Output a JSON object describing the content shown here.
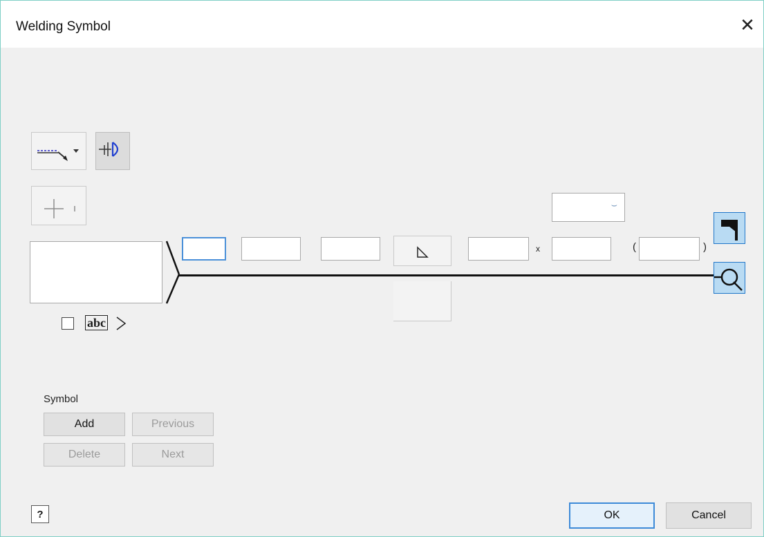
{
  "window": {
    "title": "Welding Symbol",
    "close_icon": "close-icon"
  },
  "toolbar": {
    "leader_icon": "leader-arrow-icon",
    "identification_line_icon": "identification-line-icon",
    "weld_all_around_icon": "weld-all-around-icon"
  },
  "reference": {
    "dimension_separator_x": "x",
    "paren_open": "(",
    "paren_close": ")",
    "contour_dropdown_value": ""
  },
  "tail": {
    "text_label": "abc",
    "checked": false
  },
  "side_buttons": {
    "field_weld_icon": "field-weld-flag-icon",
    "all_around_icon": "all-around-circle-icon"
  },
  "symbol_group": {
    "label": "Symbol",
    "add": "Add",
    "previous": "Previous",
    "delete": "Delete",
    "next": "Next"
  },
  "footer": {
    "help_icon": "help-icon",
    "ok": "OK",
    "cancel": "Cancel"
  },
  "colors": {
    "accent": "#1f76c9",
    "selected_bg": "#b9dbf3",
    "dialog_bg": "#f0f0f0",
    "frame": "#7fcfc6"
  }
}
